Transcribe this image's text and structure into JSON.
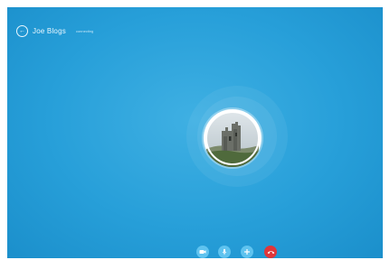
{
  "header": {
    "back_icon": "back-arrow-icon",
    "contact_name": "Joe Blogs",
    "status": "connecting"
  },
  "avatar": {
    "image": "castle-ruin-photo"
  },
  "controls": {
    "icons": [
      "video-icon",
      "microphone-icon",
      "add-icon",
      "end-call-icon"
    ]
  },
  "colors": {
    "background": "#279fd9",
    "control_button": "#5fc3ef",
    "end_call": "#e0363a"
  }
}
